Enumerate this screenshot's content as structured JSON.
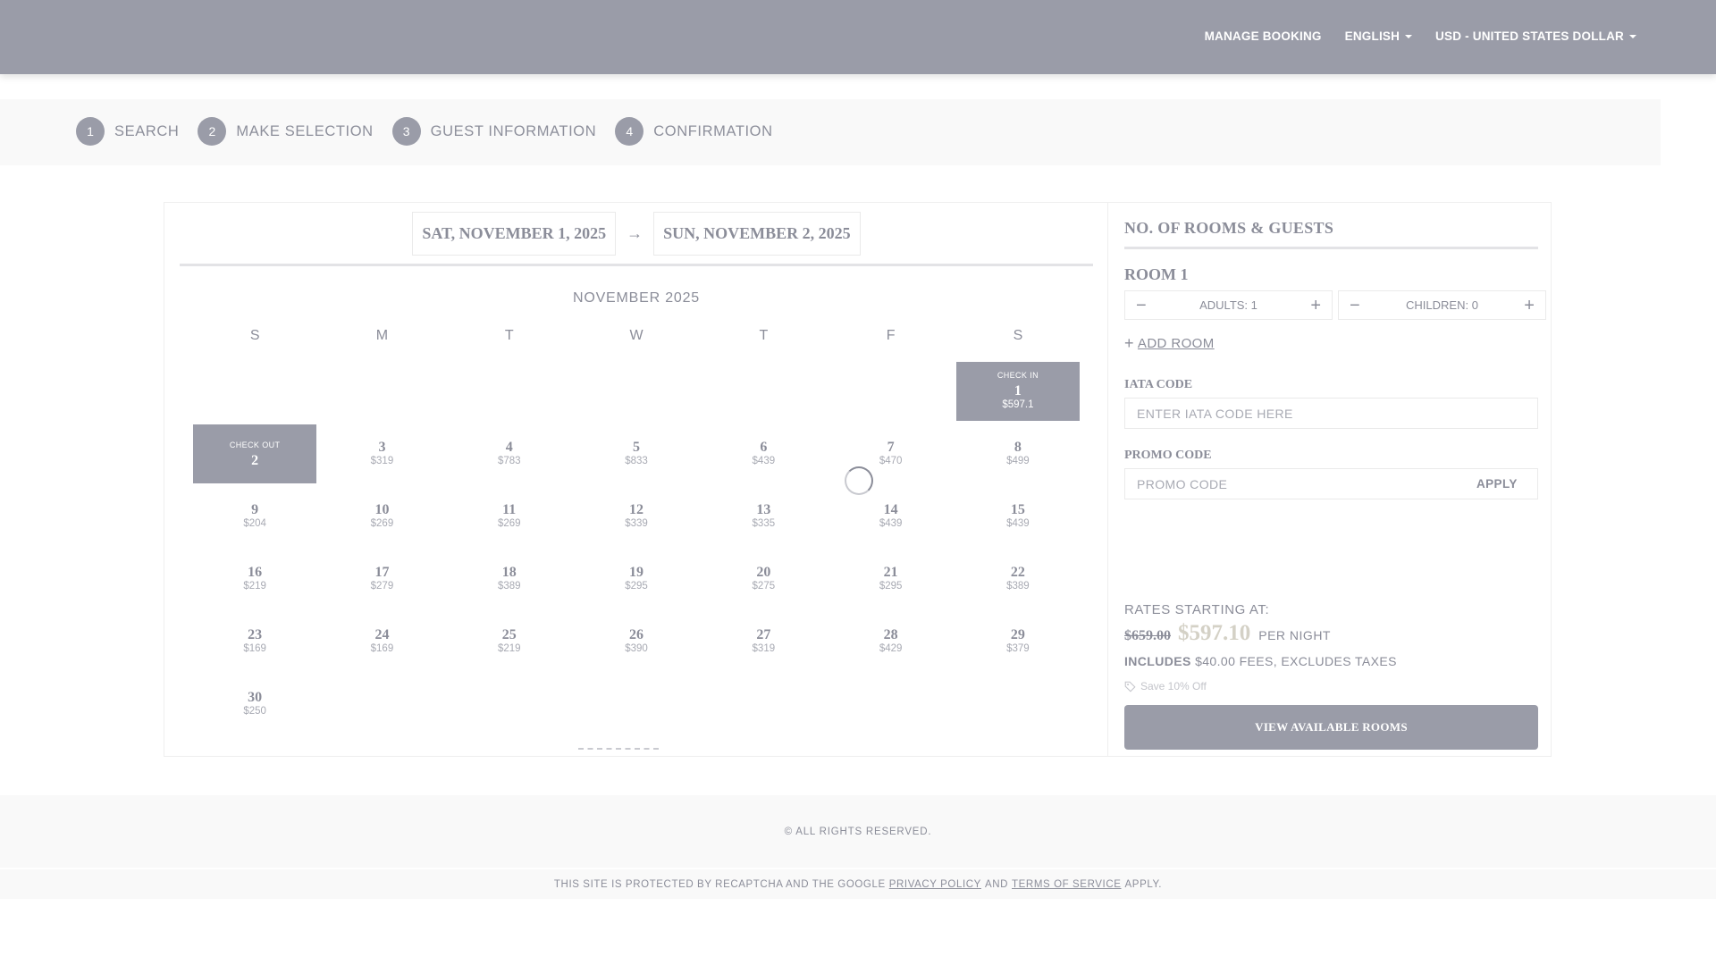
{
  "header": {
    "manage_booking": "MANAGE BOOKING",
    "language": "ENGLISH",
    "currency": "USD - UNITED STATES DOLLAR"
  },
  "steps": [
    {
      "num": "1",
      "label": "SEARCH"
    },
    {
      "num": "2",
      "label": "MAKE SELECTION"
    },
    {
      "num": "3",
      "label": "GUEST INFORMATION"
    },
    {
      "num": "4",
      "label": "CONFIRMATION"
    }
  ],
  "dates": {
    "check_in": "SAT, NOVEMBER 1, 2025",
    "arrow": "→",
    "check_out": "SUN, NOVEMBER 2, 2025"
  },
  "calendar": {
    "month": "NOVEMBER 2025",
    "dow": [
      "S",
      "M",
      "T",
      "W",
      "T",
      "F",
      "S"
    ],
    "check_in_label": "CHECK IN",
    "check_out_label": "CHECK OUT",
    "weeks": [
      [
        null,
        null,
        null,
        null,
        null,
        null,
        {
          "day": "1",
          "price": "$597.1",
          "state": "checkin"
        }
      ],
      [
        {
          "day": "2",
          "price": "",
          "state": "checkout"
        },
        {
          "day": "3",
          "price": "$319"
        },
        {
          "day": "4",
          "price": "$783"
        },
        {
          "day": "5",
          "price": "$833"
        },
        {
          "day": "6",
          "price": "$439"
        },
        {
          "day": "7",
          "price": "$470"
        },
        {
          "day": "8",
          "price": "$499"
        }
      ],
      [
        {
          "day": "9",
          "price": "$204"
        },
        {
          "day": "10",
          "price": "$269"
        },
        {
          "day": "11",
          "price": "$269"
        },
        {
          "day": "12",
          "price": "$339"
        },
        {
          "day": "13",
          "price": "$335"
        },
        {
          "day": "14",
          "price": "$439"
        },
        {
          "day": "15",
          "price": "$439"
        }
      ],
      [
        {
          "day": "16",
          "price": "$219"
        },
        {
          "day": "17",
          "price": "$279"
        },
        {
          "day": "18",
          "price": "$389"
        },
        {
          "day": "19",
          "price": "$295"
        },
        {
          "day": "20",
          "price": "$275"
        },
        {
          "day": "21",
          "price": "$295"
        },
        {
          "day": "22",
          "price": "$389"
        }
      ],
      [
        {
          "day": "23",
          "price": "$169"
        },
        {
          "day": "24",
          "price": "$169"
        },
        {
          "day": "25",
          "price": "$219"
        },
        {
          "day": "26",
          "price": "$390"
        },
        {
          "day": "27",
          "price": "$319"
        },
        {
          "day": "28",
          "price": "$429"
        },
        {
          "day": "29",
          "price": "$379"
        }
      ],
      [
        {
          "day": "30",
          "price": "$250"
        },
        null,
        null,
        null,
        null,
        null,
        null
      ]
    ]
  },
  "sidebar": {
    "title": "NO. OF ROOMS & GUESTS",
    "room_title": "ROOM 1",
    "adults": "ADULTS: 1",
    "children": "CHILDREN: 0",
    "minus": "−",
    "plus": "+",
    "add_room": "ADD ROOM",
    "iata_label": "IATA CODE",
    "iata_placeholder": "ENTER IATA CODE HERE",
    "promo_label": "PROMO CODE",
    "promo_placeholder": "PROMO CODE",
    "apply": "APPLY",
    "rates_label": "RATES STARTING AT:",
    "old_price": "$659.00",
    "new_price": "$597.10",
    "per_night": "PER NIGHT",
    "includes_bold": "INCLUDES",
    "includes_rest": "$40.00 FEES, EXCLUDES TAXES",
    "save": "Save 10% Off",
    "view_button": "VIEW AVAILABLE ROOMS"
  },
  "footer": {
    "rights": "© ALL RIGHTS RESERVED.",
    "recaptcha_pre": "THIS SITE IS PROTECTED BY RECAPTCHA AND THE GOOGLE",
    "privacy": "PRIVACY POLICY",
    "and": "AND",
    "terms": "TERMS OF SERVICE",
    "apply": "APPLY."
  }
}
